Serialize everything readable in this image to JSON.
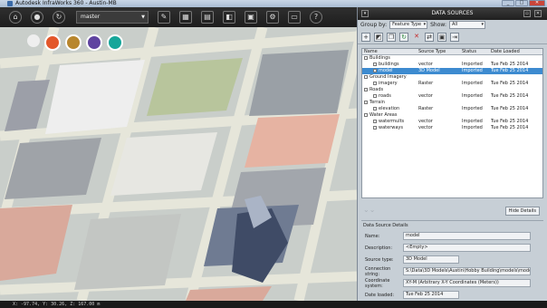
{
  "window": {
    "title": "Autodesk InfraWorks 360 - Austin-MB",
    "min": "_",
    "max": "□",
    "close": "✕"
  },
  "toolbar": {
    "proposal": "master"
  },
  "panel": {
    "title": "DATA SOURCES",
    "group_by_label": "Group by:",
    "group_by_value": "Feature Type",
    "show_label": "Show:",
    "show_value": "All",
    "columns": [
      "Name",
      "Source Type",
      "Status",
      "Date Loaded"
    ],
    "rows": [
      {
        "name": "Buildings",
        "type": "",
        "status": "",
        "date": "",
        "level": 0,
        "selected": false
      },
      {
        "name": "buildings",
        "type": "vector",
        "status": "Imported",
        "date": "Tue Feb 25 2014",
        "level": 1,
        "selected": false
      },
      {
        "name": "model",
        "type": "3D Model",
        "status": "Imported",
        "date": "Tue Feb 25 2014",
        "level": 1,
        "selected": true
      },
      {
        "name": "Ground Imagery",
        "type": "",
        "status": "",
        "date": "",
        "level": 0,
        "selected": false
      },
      {
        "name": "imagery",
        "type": "Raster",
        "status": "Imported",
        "date": "Tue Feb 25 2014",
        "level": 1,
        "selected": false
      },
      {
        "name": "Roads",
        "type": "",
        "status": "",
        "date": "",
        "level": 0,
        "selected": false
      },
      {
        "name": "roads",
        "type": "vector",
        "status": "Imported",
        "date": "Tue Feb 25 2014",
        "level": 1,
        "selected": false
      },
      {
        "name": "Terrain",
        "type": "",
        "status": "",
        "date": "",
        "level": 0,
        "selected": false
      },
      {
        "name": "elevation",
        "type": "Raster",
        "status": "Imported",
        "date": "Tue Feb 25 2014",
        "level": 1,
        "selected": false
      },
      {
        "name": "Water Areas",
        "type": "",
        "status": "",
        "date": "",
        "level": 0,
        "selected": false
      },
      {
        "name": "watermults",
        "type": "vector",
        "status": "Imported",
        "date": "Tue Feb 25 2014",
        "level": 1,
        "selected": false
      },
      {
        "name": "waterways",
        "type": "vector",
        "status": "Imported",
        "date": "Tue Feb 25 2014",
        "level": 1,
        "selected": false
      }
    ],
    "hide_details": "Hide Details",
    "details_title": "Data Source Details",
    "details": [
      {
        "label": "Name:",
        "value": "model",
        "short": false
      },
      {
        "label": "Description:",
        "value": "<Empty>",
        "short": false
      },
      {
        "label": "Source type:",
        "value": "3D Model",
        "short": true
      },
      {
        "label": "Connection string:",
        "value": "S:\\Data\\3D Models\\Austin\\Hobby Building\\models\\model.dae",
        "short": false
      },
      {
        "label": "Coordinate system:",
        "value": "XY-M (Arbitrary X-Y Coordinates (Meters))",
        "short": false
      },
      {
        "label": "Date loaded:",
        "value": "Tue Feb 25 2014",
        "short": true
      }
    ]
  },
  "status": {
    "coords": "X: -97.74,  Y: 30.26,  Z: 167.00 m"
  }
}
